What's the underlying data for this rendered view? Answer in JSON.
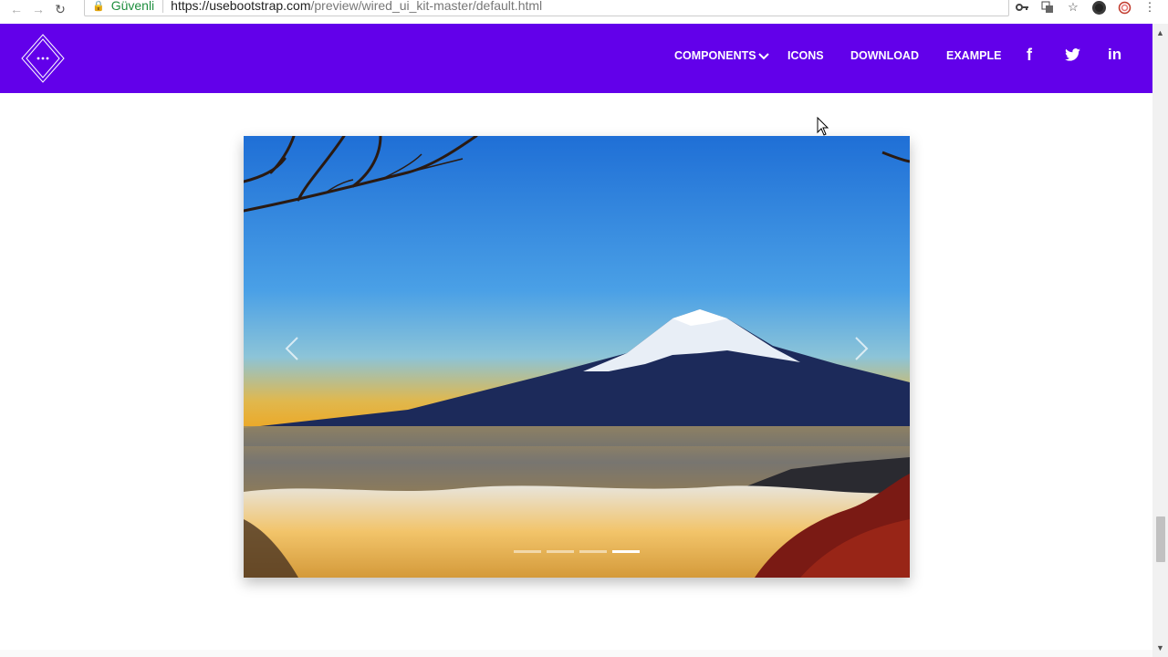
{
  "browser": {
    "secure_label": "Güvenli",
    "url_host": "https://usebootstrap.com",
    "url_path": "/preview/wired_ui_kit-master/default.html"
  },
  "nav": {
    "components": "COMPONENTS",
    "icons": "ICONS",
    "download": "DOWNLOAD",
    "example": "EXAMPLE"
  },
  "social": {
    "facebook": "f",
    "linkedin": "in"
  },
  "carousel": {
    "slide_count": 4,
    "active_index": 3
  },
  "colors": {
    "header": "#6200ea",
    "secure": "#1e8e3e"
  }
}
